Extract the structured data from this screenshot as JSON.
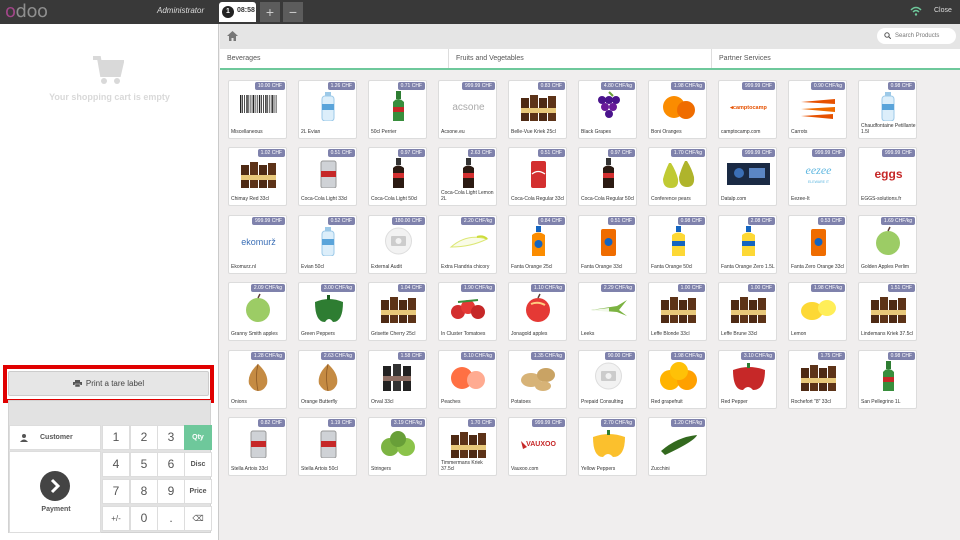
{
  "header": {
    "logo_a": "o",
    "logo_b": "doo",
    "user": "Administrator",
    "order_number": "1",
    "order_time": "08:58",
    "add_label": "+",
    "remove_label": "−",
    "close_label": "Close"
  },
  "cart": {
    "empty_text": "Your shopping cart is empty"
  },
  "tare": {
    "label": "Print a tare label"
  },
  "pad": {
    "customer": "Customer",
    "payment": "Payment",
    "keys": [
      [
        "1",
        "2",
        "3",
        "Qty"
      ],
      [
        "4",
        "5",
        "6",
        "Disc"
      ],
      [
        "7",
        "8",
        "9",
        "Price"
      ],
      [
        "+/-",
        "0",
        ".",
        "⌫"
      ]
    ]
  },
  "search": {
    "placeholder": "Search Products"
  },
  "categories": [
    "Beverages",
    "Fruits and Vegetables",
    "Partner Services"
  ],
  "colors": {
    "accent": "#6ec89b",
    "price_tag": "#7f82ac",
    "highlight": "#e00000",
    "brand": "#a24689"
  },
  "products": [
    [
      {
        "name": "Miscellaneous",
        "price": "10.00 CHF",
        "icon": "barcode"
      },
      {
        "name": "2L Evian",
        "price": "1.26 CHF",
        "icon": "water-bottle"
      },
      {
        "name": "50cl Perrier",
        "price": "0.71 CHF",
        "icon": "green-bottle"
      },
      {
        "name": "Acsone.eu",
        "price": "999.99 CHF",
        "icon": "acsone-logo"
      },
      {
        "name": "Belle-Vue Kriek 25cl",
        "price": "0.83 CHF",
        "icon": "beer-bottles"
      },
      {
        "name": "Black Grapes",
        "price": "4.80 CHF/kg",
        "icon": "grapes"
      },
      {
        "name": "Boni Oranges",
        "price": "1.98 CHF/kg",
        "icon": "orange"
      },
      {
        "name": "camptocamp.com",
        "price": "999.99 CHF",
        "icon": "camptocamp-logo"
      },
      {
        "name": "Carrots",
        "price": "0.90 CHF/kg",
        "icon": "carrots"
      },
      {
        "name": "Chaudfontaine Petillante 1.5l",
        "price": "0.98 CHF",
        "icon": "water-bottle"
      }
    ],
    [
      {
        "name": "Chimay Red 33cl",
        "price": "1.02 CHF",
        "icon": "beer-bottles"
      },
      {
        "name": "Coca-Cola Light 33cl",
        "price": "0.51 CHF",
        "icon": "silver-can"
      },
      {
        "name": "Coca-Cola Light 50cl",
        "price": "0.97 CHF",
        "icon": "dark-bottle"
      },
      {
        "name": "Coca-Cola Light Lemon 2L",
        "price": "2.63 CHF",
        "icon": "dark-bottle"
      },
      {
        "name": "Coca-Cola Regular 33cl",
        "price": "0.51 CHF",
        "icon": "red-can"
      },
      {
        "name": "Coca-Cola Regular 50cl",
        "price": "0.97 CHF",
        "icon": "dark-bottle"
      },
      {
        "name": "Conference pears",
        "price": "1.70 CHF/kg",
        "icon": "pears"
      },
      {
        "name": "Datalp.com",
        "price": "999.99 CHF",
        "icon": "datalp-logo"
      },
      {
        "name": "Eezee-It",
        "price": "999.99 CHF",
        "icon": "eezee-logo"
      },
      {
        "name": "EGGS-solutions.fr",
        "price": "999.99 CHF",
        "icon": "eggs-logo"
      }
    ],
    [
      {
        "name": "Ekomurz.nl",
        "price": "999.99 CHF",
        "icon": "ekomurz-logo"
      },
      {
        "name": "Evian 50cl",
        "price": "0.52 CHF",
        "icon": "water-bottle"
      },
      {
        "name": "External Audit",
        "price": "180.00 CHF",
        "icon": "camera-placeholder"
      },
      {
        "name": "Extra Flandria chicory",
        "price": "2.20 CHF/kg",
        "icon": "chicory"
      },
      {
        "name": "Fanta Orange 25cl",
        "price": "0.84 CHF",
        "icon": "orange-bottle"
      },
      {
        "name": "Fanta Orange 33cl",
        "price": "0.51 CHF",
        "icon": "orange-can"
      },
      {
        "name": "Fanta Orange 50cl",
        "price": "0.98 CHF",
        "icon": "yellow-bottle"
      },
      {
        "name": "Fanta Orange Zero 1.5L",
        "price": "2.08 CHF",
        "icon": "yellow-bottle"
      },
      {
        "name": "Fanta Zero Orange 33cl",
        "price": "0.53 CHF",
        "icon": "orange-can"
      },
      {
        "name": "Golden Apples Perlim",
        "price": "1.69 CHF/kg",
        "icon": "green-apple"
      }
    ],
    [
      {
        "name": "Granny Smith apples",
        "price": "2.09 CHF/kg",
        "icon": "green-apple"
      },
      {
        "name": "Green Peppers",
        "price": "3.00 CHF/kg",
        "icon": "green-pepper"
      },
      {
        "name": "Grisette Cherry 25cl",
        "price": "1.04 CHF",
        "icon": "beer-bottles"
      },
      {
        "name": "In Cluster Tomatoes",
        "price": "1.90 CHF/kg",
        "icon": "tomatoes"
      },
      {
        "name": "Jonagold apples",
        "price": "1.10 CHF/kg",
        "icon": "red-apple"
      },
      {
        "name": "Leeks",
        "price": "2.29 CHF/kg",
        "icon": "leeks"
      },
      {
        "name": "Leffe Blonde 33cl",
        "price": "1.00 CHF",
        "icon": "beer-bottles"
      },
      {
        "name": "Leffe Brune 33cl",
        "price": "1.00 CHF",
        "icon": "beer-bottles"
      },
      {
        "name": "Lemon",
        "price": "1.98 CHF/kg",
        "icon": "lemon"
      },
      {
        "name": "Lindemans Kriek 37.5cl",
        "price": "1.51 CHF",
        "icon": "beer-bottles"
      }
    ],
    [
      {
        "name": "Onions",
        "price": "1.28 CHF/kg",
        "icon": "onion"
      },
      {
        "name": "Orange Butterfly",
        "price": "2.63 CHF/kg",
        "icon": "onion"
      },
      {
        "name": "Orval 33cl",
        "price": "1.58 CHF",
        "icon": "dark-bottles"
      },
      {
        "name": "Peaches",
        "price": "5.10 CHF/kg",
        "icon": "peaches"
      },
      {
        "name": "Potatoes",
        "price": "1.35 CHF/kg",
        "icon": "potatoes"
      },
      {
        "name": "Prepaid Consulting",
        "price": "90.00 CHF",
        "icon": "camera-placeholder"
      },
      {
        "name": "Red grapefruit",
        "price": "1.98 CHF/kg",
        "icon": "grapefruit"
      },
      {
        "name": "Red Pepper",
        "price": "3.10 CHF/kg",
        "icon": "red-pepper"
      },
      {
        "name": "Rochefort \"8\" 33cl",
        "price": "1.75 CHF",
        "icon": "beer-bottles"
      },
      {
        "name": "San Pellegrino 1L",
        "price": "0.98 CHF",
        "icon": "green-bottle"
      }
    ],
    [
      {
        "name": "Stella Artois 33cl",
        "price": "0.82 CHF",
        "icon": "silver-can"
      },
      {
        "name": "Stella Artois 50cl",
        "price": "1.19 CHF",
        "icon": "silver-can"
      },
      {
        "name": "Stringers",
        "price": "3.19 CHF/kg",
        "icon": "limes"
      },
      {
        "name": "Timmermans Kriek 37.5cl",
        "price": "1.70 CHF",
        "icon": "beer-bottles"
      },
      {
        "name": "Vauxoo.com",
        "price": "999.99 CHF",
        "icon": "vauxoo-logo"
      },
      {
        "name": "Yellow Peppers",
        "price": "2.70 CHF/kg",
        "icon": "yellow-pepper"
      },
      {
        "name": "Zucchini",
        "price": "1.20 CHF/kg",
        "icon": "zucchini"
      }
    ]
  ]
}
